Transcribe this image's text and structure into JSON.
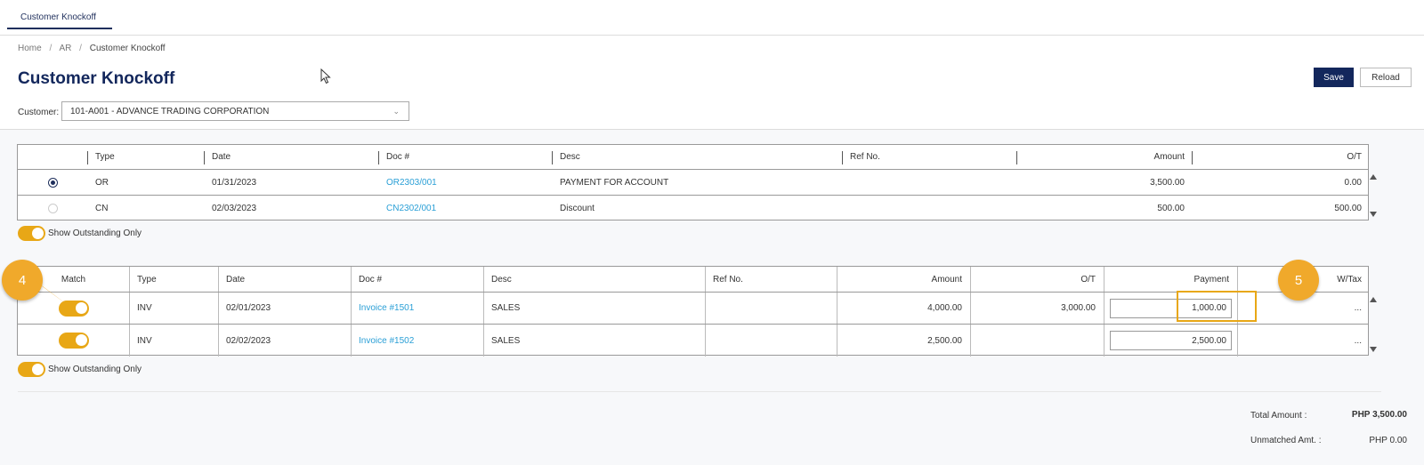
{
  "tab": {
    "label": "Customer Knockoff"
  },
  "breadcrumb": {
    "home": "Home",
    "ar": "AR",
    "current": "Customer Knockoff",
    "sep": "/"
  },
  "page": {
    "title": "Customer Knockoff"
  },
  "toolbar": {
    "save_label": "Save",
    "reload_label": "Reload"
  },
  "customer": {
    "label": "Customer:",
    "value": "101-A001 - ADVANCE TRADING CORPORATION"
  },
  "top_grid": {
    "headers": {
      "type": "Type",
      "date": "Date",
      "doc": "Doc #",
      "desc": "Desc",
      "ref": "Ref No.",
      "amount": "Amount",
      "ot": "O/T"
    },
    "rows": [
      {
        "selected": true,
        "type": "OR",
        "date": "01/31/2023",
        "doc": "OR2303/001",
        "desc": "PAYMENT FOR ACCOUNT",
        "ref": "",
        "amount": "3,500.00",
        "ot": "0.00"
      },
      {
        "selected": false,
        "type": "CN",
        "date": "02/03/2023",
        "doc": "CN2302/001",
        "desc": "Discount",
        "ref": "",
        "amount": "500.00",
        "ot": "500.00"
      }
    ],
    "show_outstanding_label": "Show Outstanding Only"
  },
  "bottom_grid": {
    "headers": {
      "match": "Match",
      "type": "Type",
      "date": "Date",
      "doc": "Doc #",
      "desc": "Desc",
      "ref": "Ref No.",
      "amount": "Amount",
      "ot": "O/T",
      "payment": "Payment",
      "wtax": "W/Tax"
    },
    "rows": [
      {
        "matched": true,
        "type": "INV",
        "date": "02/01/2023",
        "doc": "Invoice #1501",
        "desc": "SALES",
        "ref": "",
        "amount": "4,000.00",
        "ot": "3,000.00",
        "payment": "1,000.00",
        "wtax": "..."
      },
      {
        "matched": true,
        "type": "INV",
        "date": "02/02/2023",
        "doc": "Invoice #1502",
        "desc": "SALES",
        "ref": "",
        "amount": "2,500.00",
        "ot": "",
        "payment": "2,500.00",
        "wtax": "..."
      }
    ],
    "show_outstanding_label": "Show Outstanding Only"
  },
  "callouts": {
    "step4": "4",
    "step5": "5"
  },
  "totals": {
    "total_amount_label": "Total Amount :",
    "total_amount_value": "PHP 3,500.00",
    "unmatched_label": "Unmatched Amt. :",
    "unmatched_value": "PHP 0.00"
  },
  "colors": {
    "primary": "#13275c",
    "accent": "#e8a716",
    "link": "#2a9fd6"
  }
}
